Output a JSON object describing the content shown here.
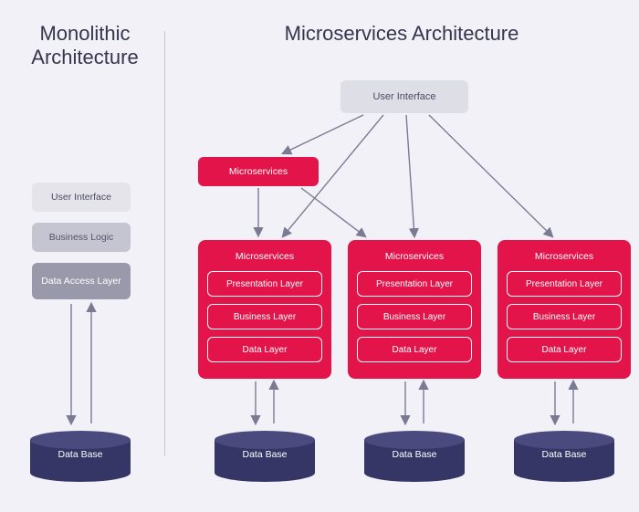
{
  "monolithic": {
    "title": "Monolithic Architecture",
    "layers": {
      "ui": "User Interface",
      "business": "Business Logic",
      "data_access": "Data Access Layer"
    },
    "database": "Data Base"
  },
  "microservices": {
    "title": "Microservices Architecture",
    "ui": "User Interface",
    "router": "Microservices",
    "service_card": {
      "title": "Microservices",
      "presentation": "Presentation Layer",
      "business": "Business Layer",
      "data": "Data Layer"
    },
    "database": "Data Base"
  },
  "colors": {
    "accent": "#e2144a",
    "dark": "#353566",
    "light_box": "#dedee6",
    "background": "#f2f1f8"
  }
}
